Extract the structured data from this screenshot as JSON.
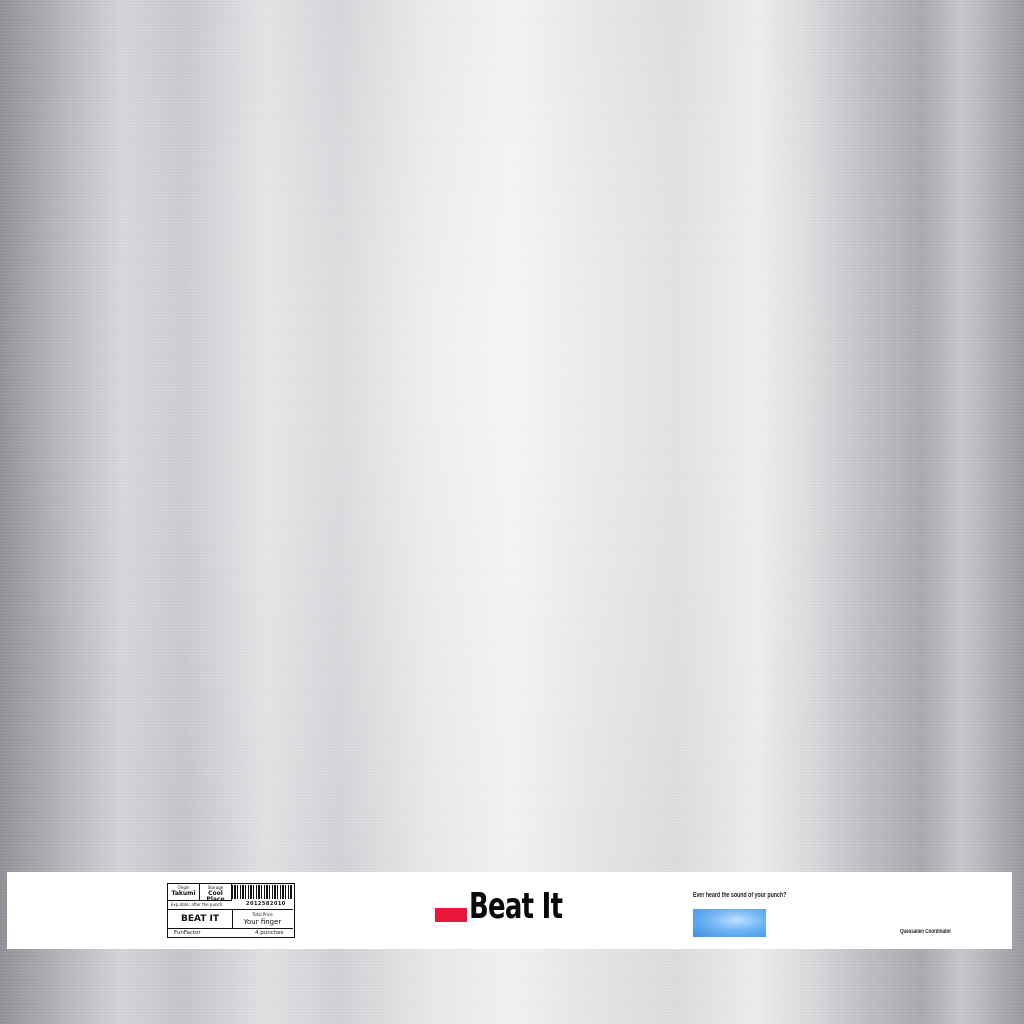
{
  "label": {
    "origin_label": "Origin",
    "origin_value": "Takumi",
    "storage_label": "Storage",
    "storage_value": "Cool Place",
    "exp_date": "Exp.date: after the punch",
    "code": "2012582010",
    "product_name": "BEAT IT",
    "total_price_label": "Total Price",
    "total_price_value": "Your finger",
    "fun_factor_label": "FunFactor",
    "fun_factor_value": "4 punches"
  },
  "logo": {
    "text": "Beat It",
    "accent_color": "#e8173a"
  },
  "right": {
    "tagline": "Ever heard the sound of your punch?",
    "credit": "Quessalien Coordinator"
  }
}
